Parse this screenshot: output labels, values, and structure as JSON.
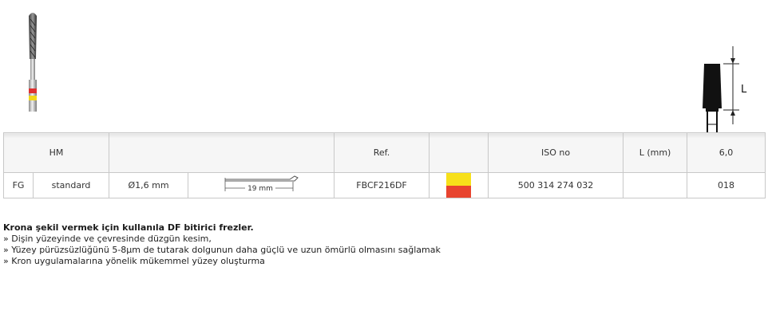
{
  "product_image": {
    "name": "dental-bur-image"
  },
  "dimension_diagram": {
    "label": "L"
  },
  "table": {
    "header": {
      "material": "HM",
      "ref": "Ref.",
      "iso": "ISO no",
      "length": "L (mm)",
      "diameter": "6,0"
    },
    "row": {
      "shank": "FG",
      "type": "standard",
      "diameter": "Ø1,6 mm",
      "shank_length": "19 mm",
      "ref": "FBCF216DF",
      "iso": "500 314 274 032",
      "length": "",
      "size": "018",
      "color_code": [
        "#f7e01a",
        "#e8442f"
      ]
    }
  },
  "description": {
    "title": "Krona şekil vermek için kullanıla DF bitirici frezler.",
    "bullets": [
      "» Dişin yüzeyinde ve çevresinde düzgün kesim,",
      "» Yüzey pürüzsüzlüğünü 5-8µm de tutarak dolgunun daha güçlü ve uzun ömürlü olmasını sağlamak",
      "» Kron uygulamalarına yönelik mükemmel yüzey oluşturma"
    ]
  }
}
